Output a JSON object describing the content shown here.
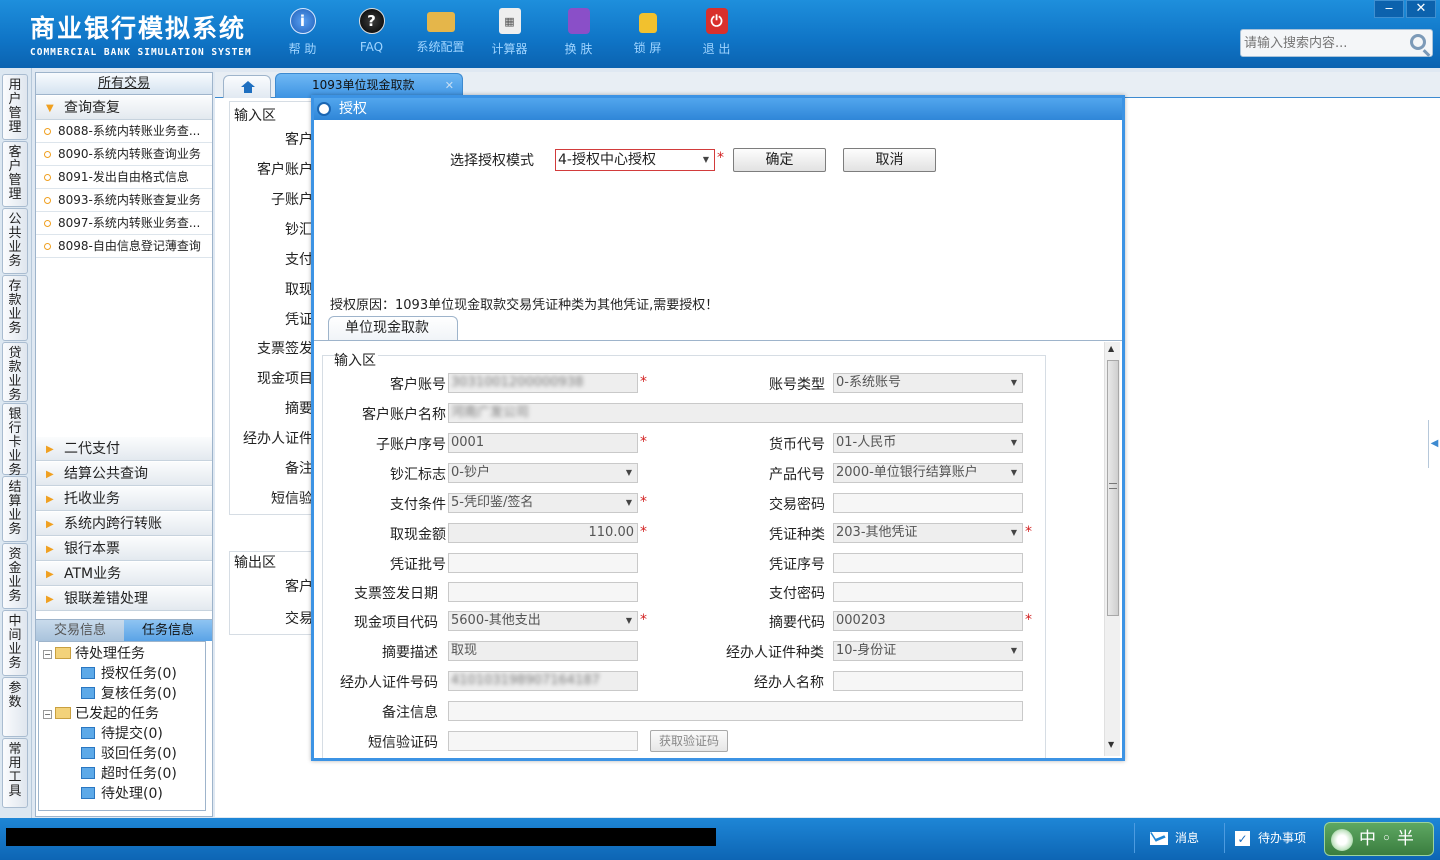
{
  "header": {
    "brand_cn": "商业银行模拟系统",
    "brand_en": "COMMERCIAL BANK SIMULATION SYSTEM",
    "toolbar": [
      {
        "label": "帮 助",
        "icon": "help-icon",
        "glyph": "i"
      },
      {
        "label": "FAQ",
        "icon": "faq-icon",
        "glyph": "?"
      },
      {
        "label": "系统配置",
        "icon": "config-icon",
        "glyph": ""
      },
      {
        "label": "计算器",
        "icon": "calculator-icon",
        "glyph": "▦"
      },
      {
        "label": "换 肤",
        "icon": "skin-icon",
        "glyph": ""
      },
      {
        "label": "锁 屏",
        "icon": "lock-icon",
        "glyph": ""
      },
      {
        "label": "退 出",
        "icon": "exit-icon",
        "glyph": "⏻"
      }
    ],
    "search_placeholder": "请输入搜索内容...",
    "minimize": "‒",
    "close": "✕"
  },
  "vtabs": [
    "用户管理",
    "客户管理",
    "公共业务",
    "存款业务",
    "贷款业务",
    "银行卡业务",
    "结算业务",
    "资金业务",
    "中间业务",
    "参数",
    "常用工具"
  ],
  "nav": {
    "title": "所有交易",
    "open_group": "查询查复",
    "items": [
      "8088-系统内转账业务查...",
      "8090-系统内转账查询业务",
      "8091-发出自由格式信息",
      "8093-系统内转账查复业务",
      "8097-系统内转账业务查...",
      "8098-自由信息登记薄查询"
    ],
    "groups": [
      "二代支付",
      "结算公共查询",
      "托收业务",
      "系统内跨行转账",
      "银行本票",
      "ATM业务",
      "银联差错处理"
    ],
    "task_tabs": [
      "交易信息",
      "任务信息"
    ],
    "tree": {
      "pending": "待处理任务",
      "pending_children": [
        "授权任务(0)",
        "复核任务(0)"
      ],
      "initiated": "已发起的任务",
      "initiated_children": [
        "待提交(0)",
        "驳回任务(0)",
        "超时任务(0)",
        "待处理(0)"
      ]
    }
  },
  "tabs": {
    "active": "1093单位现金取款",
    "close": "✕"
  },
  "background_form": {
    "input_zone": "输入区",
    "labels": [
      "客户",
      "客户账户",
      "子账户",
      "钞汇",
      "支付",
      "取现",
      "凭证",
      "支票签发",
      "现金项目",
      "摘要",
      "经办人证件",
      "备注",
      "短信验"
    ],
    "output_zone": "输出区",
    "output_labels": [
      "客户",
      "交易"
    ]
  },
  "dialog": {
    "title": "授权",
    "mode_label": "选择授权模式",
    "mode_value": "4-授权中心授权",
    "confirm": "确定",
    "cancel": "取消",
    "reason": "授权原因：1093单位现金取款交易凭证种类为其他凭证,需要授权！",
    "sub_tab": "单位现金取款",
    "zone_title": "输入区",
    "fields": {
      "customer_account": {
        "label": "客户账号",
        "value": "3031001200000938"
      },
      "account_type": {
        "label": "账号类型",
        "value": "0-系统账号"
      },
      "account_name": {
        "label": "客户账户名称",
        "value": "河南广发公司"
      },
      "sub_account_no": {
        "label": "子账户序号",
        "value": "0001"
      },
      "currency": {
        "label": "货币代号",
        "value": "01-人民币"
      },
      "cash_flag": {
        "label": "钞汇标志",
        "value": "0-钞户"
      },
      "product_code": {
        "label": "产品代号",
        "value": "2000-单位银行结算账户"
      },
      "pay_condition": {
        "label": "支付条件",
        "value": "5-凭印鉴/签名"
      },
      "trade_password": {
        "label": "交易密码",
        "value": ""
      },
      "amount": {
        "label": "取现金额",
        "value": "110.00"
      },
      "voucher_type": {
        "label": "凭证种类",
        "value": "203-其他凭证"
      },
      "voucher_batch": {
        "label": "凭证批号",
        "value": ""
      },
      "voucher_seq": {
        "label": "凭证序号",
        "value": ""
      },
      "check_date": {
        "label": "支票签发日期",
        "value": ""
      },
      "pay_password": {
        "label": "支付密码",
        "value": ""
      },
      "cash_item": {
        "label": "现金项目代码",
        "value": "5600-其他支出"
      },
      "summary_code": {
        "label": "摘要代码",
        "value": "000203"
      },
      "summary_desc": {
        "label": "摘要描述",
        "value": "取现"
      },
      "agent_id_type": {
        "label": "经办人证件种类",
        "value": "10-身份证"
      },
      "agent_id_no": {
        "label": "经办人证件号码",
        "value": "410103198907164187"
      },
      "agent_name": {
        "label": "经办人名称",
        "value": ""
      },
      "remark": {
        "label": "备注信息",
        "value": ""
      },
      "sms_code": {
        "label": "短信验证码",
        "value": ""
      }
    },
    "get_code_button": "获取验证码",
    "required_mark": "*"
  },
  "statusbar": {
    "message": "消息",
    "todo": "待办事项",
    "ime": "中 ◦ 半 简"
  }
}
